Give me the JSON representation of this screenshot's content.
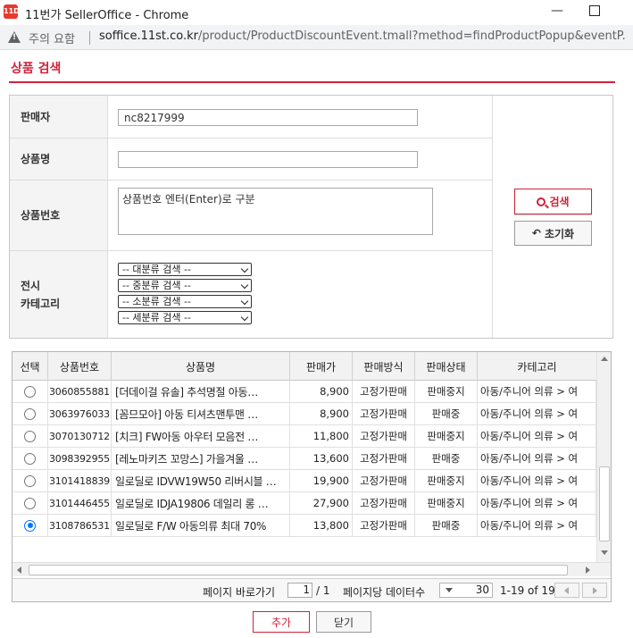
{
  "window": {
    "app_icon": "11D",
    "title": "11번가 SellerOffice - Chrome"
  },
  "addressbar": {
    "warning": "주의 요함",
    "url_host": "soffice.11st.co.kr",
    "url_path": "/product/ProductDiscountEvent.tmall?method=findProductPopup&eventP..."
  },
  "page": {
    "title": "상품 검색"
  },
  "form": {
    "seller_label": "판매자",
    "seller_value": "nc8217999",
    "product_name_label": "상품명",
    "product_name_value": "",
    "product_no_label": "상품번호",
    "product_no_placeholder": "상품번호 엔터(Enter)로 구분",
    "category_label_1": "전시",
    "category_label_2": "카테고리",
    "category_selects": [
      "-- 대분류 검색 --",
      "-- 중분류 검색 --",
      "-- 소분류 검색 --",
      "-- 세분류 검색 --"
    ],
    "search_button": "검색",
    "reset_button": "초기화"
  },
  "grid": {
    "columns": [
      "선택",
      "상품번호",
      "상품명",
      "판매가",
      "판매방식",
      "판매상태",
      "카테고리"
    ],
    "rows": [
      {
        "selected": false,
        "no": "3060855881",
        "name": "[더데이걸 유솔] 추석명절 아동…",
        "price": "8,900",
        "method": "고정가판매",
        "status": "판매중지",
        "category": "아동/주니어 의류 > 여"
      },
      {
        "selected": false,
        "no": "3063976033",
        "name": "[꼼므모아] 아동 티셔츠맨투맨 …",
        "price": "8,900",
        "method": "고정가판매",
        "status": "판매중",
        "category": "아동/주니어 의류 > 여"
      },
      {
        "selected": false,
        "no": "3070130712",
        "name": "[치크] FW아동 아우터 모음전 …",
        "price": "11,800",
        "method": "고정가판매",
        "status": "판매중지",
        "category": "아동/주니어 의류 > 여"
      },
      {
        "selected": false,
        "no": "3098392955",
        "name": "[레노마키즈 꼬망스] 가을겨울 …",
        "price": "13,600",
        "method": "고정가판매",
        "status": "판매중",
        "category": "아동/주니어 의류 > 여"
      },
      {
        "selected": false,
        "no": "3101418839",
        "name": "일로딜로 IDVW19W50 리버시블 …",
        "price": "19,900",
        "method": "고정가판매",
        "status": "판매중지",
        "category": "아동/주니어 의류 > 여"
      },
      {
        "selected": false,
        "no": "3101446455",
        "name": "일로딜로 IDJA19806 데일리 롱 …",
        "price": "27,900",
        "method": "고정가판매",
        "status": "판매중지",
        "category": "아동/주니어 의류 > 여"
      },
      {
        "selected": true,
        "no": "3108786531",
        "name": "일로딜로 F/W 아동의류 최대 70%",
        "price": "13,800",
        "method": "고정가판매",
        "status": "판매중",
        "category": "아동/주니어 의류 > 여"
      }
    ]
  },
  "pager": {
    "goto_label": "페이지 바로가기",
    "current_page": "1",
    "total_pages": "/ 1",
    "per_page_label": "페이지당 데이터수",
    "per_page": "30",
    "range": "1-19 of 19"
  },
  "footer": {
    "add_button": "추가",
    "close_button": "닫기"
  },
  "colors": {
    "accent": "#d0233a",
    "radio_selected": "#0075ff"
  }
}
